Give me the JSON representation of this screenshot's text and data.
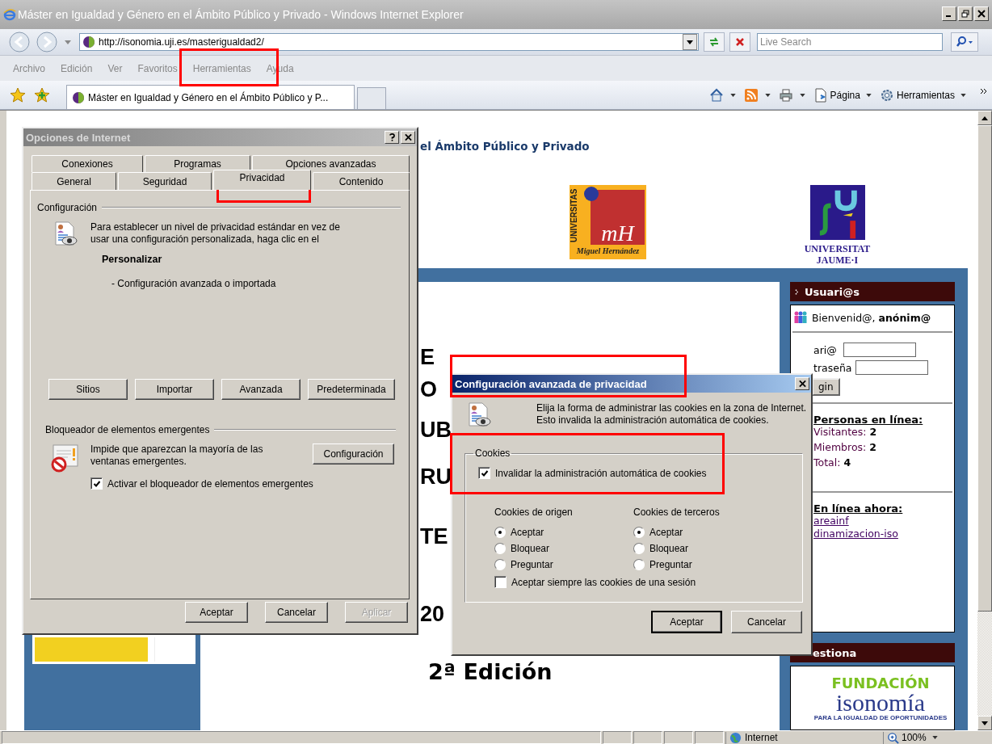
{
  "window": {
    "title": "Máster en Igualdad y Género en el Ámbito Público y Privado - Windows Internet Explorer"
  },
  "address_bar": {
    "url": "http://isonomia.uji.es/masterigualdad2/"
  },
  "search": {
    "placeholder": "Live Search"
  },
  "menu": [
    "Archivo",
    "Edición",
    "Ver",
    "Favoritos",
    "Herramientas",
    "Ayuda"
  ],
  "browser_tab": {
    "title": "Máster en Igualdad y Género en el Ámbito Público y P..."
  },
  "commands": [
    "Página",
    "Herramientas"
  ],
  "page": {
    "heading": "el Ámbito Público y Privado",
    "umh_logo": {
      "side": "UNIVERSITAS",
      "monogram": "mH",
      "caption": "Miguel Hernández"
    },
    "uji_logo": {
      "line_1": "UNIVERSITAT",
      "line_2": "JAUME·I"
    },
    "title_fragments": [
      "E",
      "O",
      "UB",
      "RU",
      "TE",
      "20"
    ],
    "edition": "2ª Edición",
    "users_panel": {
      "header": "Usuari@s",
      "welcome": "Bienvenid@, **anónim@**",
      "fields": [
        {
          "label": "ari@"
        },
        {
          "label": "traseña"
        }
      ],
      "login_button": "gin",
      "online_heading": "Personas en línea:",
      "stats": [
        {
          "label": "Visitantes:",
          "value": "2"
        },
        {
          "label": "Miembros:",
          "value": "2"
        },
        {
          "label": "Total:",
          "value": "4"
        }
      ],
      "now_heading": "En línea ahora:",
      "users": [
        "areainf",
        "dinamizacion-iso"
      ]
    },
    "manage_panel": {
      "header": "estiona",
      "logo_top": "FUNDACIÓN",
      "logo_name": "isonomía",
      "logo_tagline": "PARA LA IGUALDAD DE OPORTUNIDADES"
    }
  },
  "internet_options": {
    "title": "Opciones de Internet",
    "tab_rows": [
      {
        "tabs": [
          {
            "label": "Conexiones",
            "selected": false
          },
          {
            "label": "Programas",
            "selected": false
          },
          {
            "label": "Opciones avanzadas",
            "selected": false
          }
        ]
      },
      {
        "tabs": [
          {
            "label": "General",
            "selected": false
          },
          {
            "label": "Seguridad",
            "selected": false
          },
          {
            "label": "Privacidad",
            "selected": true
          },
          {
            "label": "Contenido",
            "selected": false
          }
        ]
      }
    ],
    "settings_label": "Configuración",
    "description": "Para establecer un nivel de privacidad estándar en vez de usar una configuración personalizada, haga clic en el",
    "level": "Personalizar",
    "level_detail": "- Configuración avanzada o importada",
    "buttons": [
      "Sitios",
      "Importar",
      "Avanzada",
      "Predeterminada"
    ],
    "popup_label": "Bloqueador de elementos emergentes",
    "popup_text": "Impide que aparezcan la mayoría de las ventanas emergentes.",
    "popup_button": "Configuración",
    "popup_checkbox": {
      "label": "Activar el bloqueador de elementos emergentes",
      "checked": true
    },
    "footer": [
      {
        "label": "Aceptar",
        "disabled": false
      },
      {
        "label": "Cancelar",
        "disabled": false
      },
      {
        "label": "Aplicar",
        "disabled": true
      }
    ]
  },
  "advanced_privacy": {
    "title": "Configuración avanzada de privacidad",
    "description": "Elija la forma de administrar las cookies en la zona de Internet. Esto invalida la administración automática de cookies.",
    "group": "Cookies",
    "override": {
      "label": "Invalidar la administración automática de cookies",
      "checked": true
    },
    "columns": [
      {
        "heading": "Cookies de origen",
        "options": [
          {
            "label": "Aceptar",
            "selected": true
          },
          {
            "label": "Bloquear",
            "selected": false
          },
          {
            "label": "Preguntar",
            "selected": false
          }
        ]
      },
      {
        "heading": "Cookies de terceros",
        "options": [
          {
            "label": "Aceptar",
            "selected": true
          },
          {
            "label": "Bloquear",
            "selected": false
          },
          {
            "label": "Preguntar",
            "selected": false
          }
        ]
      }
    ],
    "session": {
      "label": "Aceptar siempre las cookies de una sesión",
      "checked": false
    },
    "buttons": [
      {
        "label": "Aceptar",
        "default": true
      },
      {
        "label": "Cancelar",
        "default": false
      }
    ]
  },
  "status_bar": {
    "zone": "Internet",
    "zoom": "100%"
  }
}
